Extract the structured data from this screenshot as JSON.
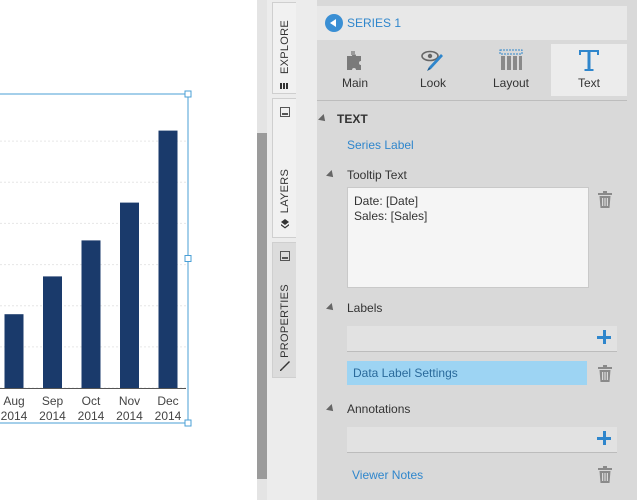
{
  "chart_data": {
    "type": "bar",
    "categories": [
      {
        "month": "Aug",
        "year": "2014"
      },
      {
        "month": "Sep",
        "year": "2014"
      },
      {
        "month": "Oct",
        "year": "2014"
      },
      {
        "month": "Nov",
        "year": "2014"
      },
      {
        "month": "Dec",
        "year": "2014"
      }
    ],
    "values": [
      41,
      62,
      82,
      103,
      143
    ],
    "ylim": [
      0,
      160
    ],
    "grid": true,
    "bar_color": "#1a3a6b"
  },
  "vertical_tabs": [
    {
      "label": "EXPLORE"
    },
    {
      "label": "LAYERS"
    },
    {
      "label": "PROPERTIES"
    }
  ],
  "panel": {
    "series_title": "SERIES 1",
    "tool_tabs": [
      {
        "label": "Main",
        "icon": "puzzle-icon"
      },
      {
        "label": "Look",
        "icon": "eye-brush-icon"
      },
      {
        "label": "Layout",
        "icon": "layout-grid-icon"
      },
      {
        "label": "Text",
        "icon": "text-t-icon"
      }
    ],
    "active_tool_tab": "Text",
    "text_section": "TEXT",
    "series_label_link": "Series Label",
    "tooltip_text_heading": "Tooltip Text",
    "tooltip_lines": [
      "Date: [Date]",
      "Sales: [Sales]"
    ],
    "labels_heading": "Labels",
    "data_label_settings": "Data Label Settings",
    "annotations_heading": "Annotations",
    "viewer_notes": "Viewer Notes"
  },
  "colors": {
    "accent": "#2f86cc",
    "selected_item": "#9dd4f3",
    "panel_bg": "#d9d9d9"
  }
}
